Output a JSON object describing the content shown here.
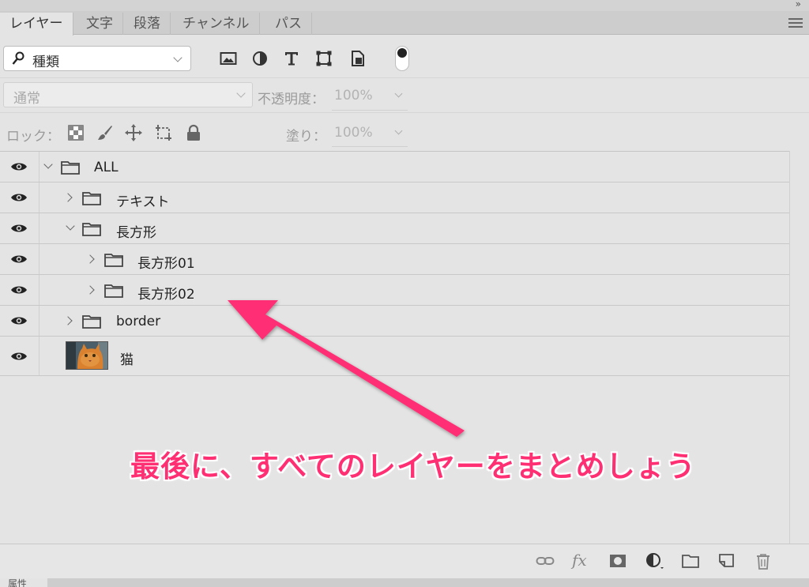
{
  "panel": {
    "collapse_glyph": "»",
    "tabs": [
      "レイヤー",
      "文字",
      "段落",
      "チャンネル",
      "パス"
    ],
    "active_tab": "レイヤー"
  },
  "filter": {
    "kind_label": "種類",
    "icons": [
      "image-filter-icon",
      "adjustment-filter-icon",
      "type-filter-icon",
      "shape-filter-icon",
      "smart-object-filter-icon"
    ],
    "toggle_on": true
  },
  "blend": {
    "mode": "通常",
    "opacity_label": "不透明度：",
    "opacity_value": "100%"
  },
  "lock": {
    "label": "ロック：",
    "icons": [
      "lock-transparent-icon",
      "lock-image-icon",
      "lock-position-icon",
      "lock-artboard-icon",
      "lock-all-icon"
    ],
    "fill_label": "塗り：",
    "fill_value": "100%"
  },
  "layers": [
    {
      "name": "ALL",
      "type": "group",
      "depth": 0,
      "expanded": true
    },
    {
      "name": "テキスト",
      "type": "group",
      "depth": 1,
      "expanded": false
    },
    {
      "name": "長方形",
      "type": "group",
      "depth": 1,
      "expanded": true
    },
    {
      "name": "長方形01",
      "type": "group",
      "depth": 2,
      "expanded": false
    },
    {
      "name": "長方形02",
      "type": "group",
      "depth": 2,
      "expanded": false
    },
    {
      "name": "border",
      "type": "group",
      "depth": 1,
      "expanded": false
    },
    {
      "name": "猫",
      "type": "image",
      "depth": 1
    }
  ],
  "bottom_icons": [
    "link-icon",
    "fx-icon",
    "mask-icon",
    "adjustment-layer-icon",
    "new-group-icon",
    "new-layer-icon",
    "trash-icon"
  ],
  "bottom_fx_label": "fx",
  "next_panel_label": "属性",
  "annotation": {
    "text": "最後に、すべてのレイヤーをまとめしょう",
    "color": "#ff2f74"
  }
}
